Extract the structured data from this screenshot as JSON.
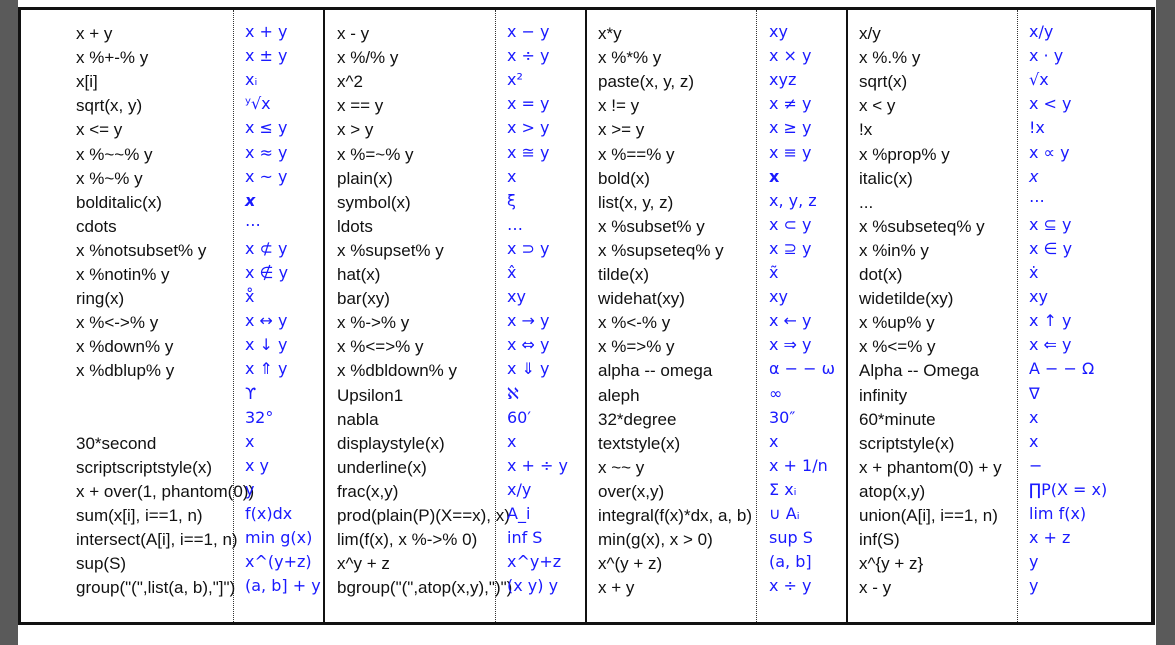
{
  "columns": [
    {
      "expr": [
        "x + y",
        "x %+-% y",
        "x[i]",
        "sqrt(x, y)",
        "x <= y",
        "x %~~% y",
        "x %~% y",
        "bolditalic(x)",
        "cdots",
        "x %notsubset% y",
        "x %notin% y",
        "ring(x)",
        "x %<->% y",
        "x %down% y",
        "x %dblup% y",
        "",
        "",
        "30*second",
        "scriptscriptstyle(x)",
        "x + over(1, phantom(0))",
        "sum(x[i], i==1, n)",
        "intersect(A[i], i==1, n)",
        "sup(S)",
        "group(\"(\",list(a, b),\"]\")"
      ],
      "render": [
        "x + y",
        "x ± y",
        "xᵢ",
        "ʸ√x",
        "x ≤ y",
        "x ≈ y",
        "x ~ y",
        "x",
        "⋯",
        "x ⊄ y",
        "x ∉ y",
        "x̊",
        "x ↔ y",
        "x ↓ y",
        "x ⇑ y",
        "ϒ",
        "32°",
        "x",
        "x  y",
        "y",
        "f(x)dx",
        "min g(x)",
        "x^(y+z)",
        "(a, b] + y"
      ]
    },
    {
      "expr": [
        "x - y",
        "x %/% y",
        "x^2",
        "x == y",
        "x > y",
        "x %=~% y",
        "plain(x)",
        "symbol(x)",
        "ldots",
        "x %supset% y",
        "hat(x)",
        "bar(xy)",
        "x %->% y",
        "x %<=>% y",
        "x %dbldown% y",
        "Upsilon1",
        "nabla",
        "displaystyle(x)",
        "underline(x)",
        "frac(x,y)",
        "prod(plain(P)(X==x), x)",
        "lim(f(x), x %->% 0)",
        "x^y + z",
        "bgroup(\"(\",atop(x,y),\")\")"
      ],
      "render": [
        "x − y",
        "x ÷ y",
        "x²",
        "x = y",
        "x > y",
        "x ≅ y",
        "x",
        "ξ",
        "…",
        "x ⊃ y",
        "x̂",
        "xy",
        "x → y",
        "x ⇔ y",
        "x ⇓ y",
        "ℵ",
        "60′",
        "x",
        "x + ÷ y",
        "x/y",
        "A_i",
        "inf S",
        "x^y+z",
        "(x y) y"
      ]
    },
    {
      "expr": [
        "x*y",
        "x %*% y",
        "paste(x, y, z)",
        "x != y",
        "x >= y",
        "x %==% y",
        "bold(x)",
        "list(x, y, z)",
        "x %subset% y",
        "x %supseteq% y",
        "tilde(x)",
        "widehat(xy)",
        "x %<-% y",
        "x %=>% y",
        "alpha -- omega",
        "aleph",
        "32*degree",
        "textstyle(x)",
        "x ~~ y",
        "over(x,y)",
        "integral(f(x)*dx, a, b)",
        "min(g(x), x > 0)",
        "x^(y + z)",
        "x + y"
      ],
      "render": [
        "xy",
        "x × y",
        "xyz",
        "x ≠ y",
        "x ≥ y",
        "x ≡ y",
        "x",
        "x, y, z",
        "x ⊂ y",
        "x ⊇ y",
        "x̃",
        "xy",
        "x ← y",
        "x ⇒ y",
        "α − − ω",
        "∞",
        "30″",
        "x",
        "x + 1/n",
        "Σ xᵢ",
        "∪ Aᵢ",
        "sup S",
        "(a, b]",
        "x ÷ y"
      ]
    },
    {
      "expr": [
        "x/y",
        "x %.% y",
        "sqrt(x)",
        "x < y",
        "!x",
        "x %prop% y",
        "italic(x)",
        "...",
        "x %subseteq% y",
        "x %in% y",
        "dot(x)",
        "widetilde(xy)",
        "x %up% y",
        "x %<=% y",
        "Alpha -- Omega",
        "infinity",
        "60*minute",
        "scriptstyle(x)",
        "x + phantom(0) + y",
        "atop(x,y)",
        "union(A[i], i==1, n)",
        "inf(S)",
        "x^{y + z}",
        "x - y"
      ],
      "render": [
        "x/y",
        "x · y",
        "√x",
        "x < y",
        "!x",
        "x ∝ y",
        "x",
        "⋯",
        "x ⊆ y",
        "x ∈ y",
        "ẋ",
        "xy",
        "x ↑ y",
        "x ⇐ y",
        "Α − − Ω",
        "∇",
        "x",
        "x",
        "−",
        "∏P(X = x)",
        "lim f(x)",
        "x + z",
        "y",
        "y"
      ]
    }
  ]
}
